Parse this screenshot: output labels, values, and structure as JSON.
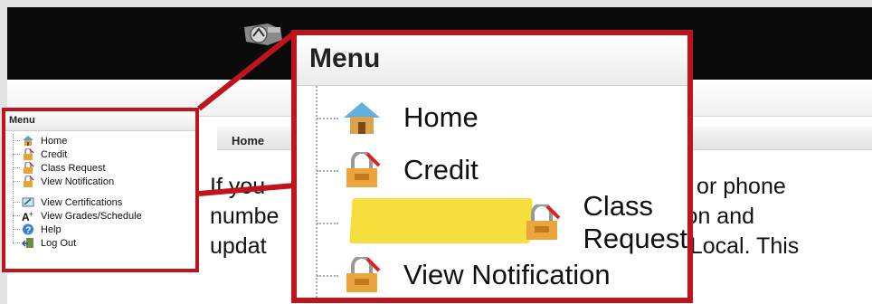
{
  "small_menu": {
    "title": "Menu",
    "items": [
      {
        "label": "Home",
        "icon": "home-icon"
      },
      {
        "label": "Credit",
        "icon": "lock-icon"
      },
      {
        "label": "Class Request",
        "icon": "lock-icon"
      },
      {
        "label": "View Notification",
        "icon": "lock-icon"
      },
      {
        "label": "View Certifications",
        "icon": "certificate-icon"
      },
      {
        "label": "View Grades/Schedule",
        "icon": "grade-icon"
      },
      {
        "label": "Help",
        "icon": "help-icon"
      },
      {
        "label": "Log Out",
        "icon": "logout-icon"
      }
    ]
  },
  "content": {
    "header": "Home",
    "text_lines": [
      "If you",
      "numbe",
      "updat"
    ],
    "text_right_lines": [
      "il or phone",
      "ion and",
      "e Local.  This"
    ]
  },
  "zoom_menu": {
    "title": "Menu",
    "items": [
      {
        "label": "Home",
        "icon": "home-icon"
      },
      {
        "label": "Credit",
        "icon": "lock-icon"
      },
      {
        "label": "Class Request",
        "icon": "lock-icon",
        "highlighted": true
      },
      {
        "label": "View Notification",
        "icon": "lock-icon"
      }
    ]
  },
  "colors": {
    "callout_red": "#c0141c",
    "highlight_yellow": "#f6df3c",
    "header_black": "#0a0a0a"
  }
}
